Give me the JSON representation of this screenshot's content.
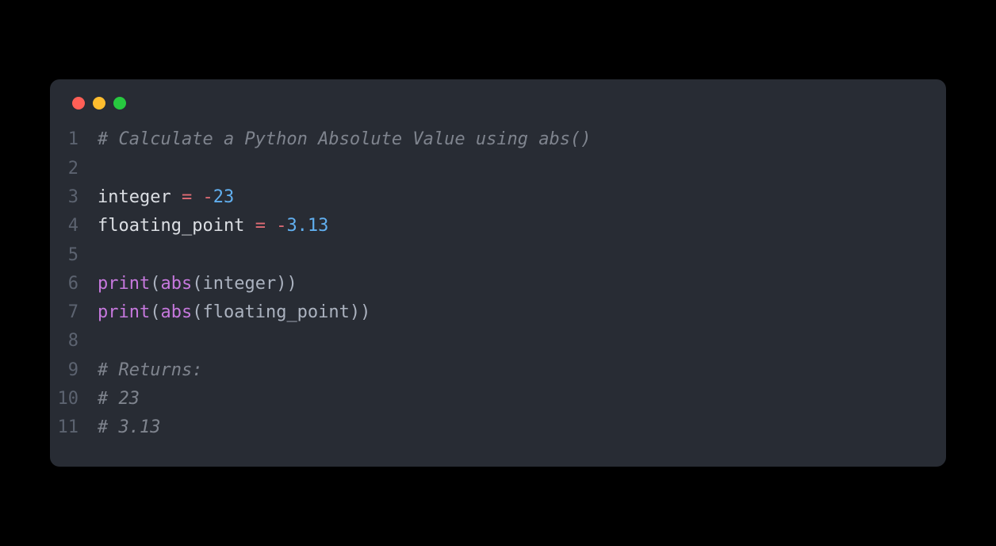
{
  "window": {
    "controls": {
      "close_color": "#ff5f56",
      "minimize_color": "#ffbd2e",
      "maximize_color": "#27c93f"
    }
  },
  "code": {
    "lines": [
      {
        "number": "1",
        "tokens": [
          {
            "text": "# Calculate a Python Absolute Value using abs()",
            "cls": "tok-comment"
          }
        ]
      },
      {
        "number": "2",
        "tokens": []
      },
      {
        "number": "3",
        "tokens": [
          {
            "text": "integer ",
            "cls": "tok-variable"
          },
          {
            "text": "=",
            "cls": "tok-equals"
          },
          {
            "text": " ",
            "cls": ""
          },
          {
            "text": "-",
            "cls": "tok-minus"
          },
          {
            "text": "23",
            "cls": "tok-number"
          }
        ]
      },
      {
        "number": "4",
        "tokens": [
          {
            "text": "floating_point ",
            "cls": "tok-variable"
          },
          {
            "text": "=",
            "cls": "tok-equals"
          },
          {
            "text": " ",
            "cls": ""
          },
          {
            "text": "-",
            "cls": "tok-minus"
          },
          {
            "text": "3.13",
            "cls": "tok-number"
          }
        ]
      },
      {
        "number": "5",
        "tokens": []
      },
      {
        "number": "6",
        "tokens": [
          {
            "text": "print",
            "cls": "tok-builtin"
          },
          {
            "text": "(",
            "cls": "tok-paren"
          },
          {
            "text": "abs",
            "cls": "tok-builtin"
          },
          {
            "text": "(integer))",
            "cls": "tok-paren"
          }
        ]
      },
      {
        "number": "7",
        "tokens": [
          {
            "text": "print",
            "cls": "tok-builtin"
          },
          {
            "text": "(",
            "cls": "tok-paren"
          },
          {
            "text": "abs",
            "cls": "tok-builtin"
          },
          {
            "text": "(floating_point))",
            "cls": "tok-paren"
          }
        ]
      },
      {
        "number": "8",
        "tokens": []
      },
      {
        "number": "9",
        "tokens": [
          {
            "text": "# Returns:",
            "cls": "tok-comment"
          }
        ]
      },
      {
        "number": "10",
        "tokens": [
          {
            "text": "# 23",
            "cls": "tok-comment"
          }
        ]
      },
      {
        "number": "11",
        "tokens": [
          {
            "text": "# 3.13",
            "cls": "tok-comment"
          }
        ]
      }
    ]
  }
}
